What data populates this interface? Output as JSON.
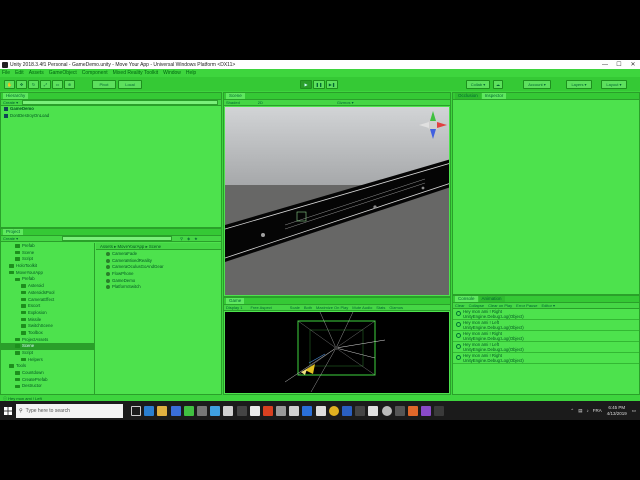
{
  "window": {
    "title": "Unity 2018.3.4f1 Personal - GameDemo.unity - Move Your App - Universal Windows Platform <DX11>",
    "minimize": "—",
    "maximize": "☐",
    "close": "✕"
  },
  "menu": [
    "File",
    "Edit",
    "Assets",
    "GameObject",
    "Component",
    "Mixed Reality Toolkit",
    "Window",
    "Help"
  ],
  "toolbar": {
    "pivot": "Pivot",
    "local": "Local",
    "collab": "Collab ▾",
    "account": "Account ▾",
    "layers": "Layers ▾",
    "layout": "Layout ▾"
  },
  "hierarchy": {
    "tab": "Hierarchy",
    "create": "Create ▾",
    "search_placeholder": "All",
    "items": [
      "GameDemo",
      "DontDestroyOnLoad"
    ]
  },
  "scene": {
    "tab": "Scene",
    "shading": "Shaded",
    "mode_2d": "2D",
    "gizmos": "Gizmos ▾",
    "search_placeholder": "All"
  },
  "game": {
    "tab": "Game",
    "display": "Display 1",
    "aspect": "Free Aspect",
    "scale": "Scale",
    "eye": "Both",
    "maximize": "Maximize On Play",
    "mute": "Mute Audio",
    "stats": "Stats",
    "gizmos": "Gizmos"
  },
  "inspector": {
    "tabs": [
      "Occlusion",
      "Inspector"
    ]
  },
  "project": {
    "tab": "Project",
    "create": "Create ▾",
    "tree": [
      {
        "label": "Prefab",
        "indent": 2
      },
      {
        "label": "Scene",
        "indent": 2
      },
      {
        "label": "Script",
        "indent": 2
      },
      {
        "label": "HoloToolkit",
        "indent": 1
      },
      {
        "label": "MoveYourApp",
        "indent": 1
      },
      {
        "label": "Prefab",
        "indent": 2
      },
      {
        "label": "Asteroid",
        "indent": 3
      },
      {
        "label": "AsteroidsPool",
        "indent": 3
      },
      {
        "label": "CameraEffect",
        "indent": 3
      },
      {
        "label": "Escort",
        "indent": 3
      },
      {
        "label": "Explosion",
        "indent": 3
      },
      {
        "label": "Missile",
        "indent": 3
      },
      {
        "label": "SwitchScene",
        "indent": 3
      },
      {
        "label": "Toolbox",
        "indent": 3
      },
      {
        "label": "ProjectAssets",
        "indent": 2
      },
      {
        "label": "Scene",
        "indent": 2,
        "selected": true
      },
      {
        "label": "Script",
        "indent": 2
      },
      {
        "label": "Helpers",
        "indent": 3
      },
      {
        "label": "Tools",
        "indent": 1
      },
      {
        "label": "Countdown",
        "indent": 2
      },
      {
        "label": "CreatePrefab",
        "indent": 2
      },
      {
        "label": "Destructor",
        "indent": 2
      }
    ],
    "breadcrumb": [
      "Assets",
      "MoveYourApp",
      "Scene"
    ],
    "assets": [
      "CameraFade",
      "CameraMixedReality",
      "CameraOculusGoAndGear",
      "FlowPhone",
      "GameDemo",
      "PlatformSwitch"
    ]
  },
  "console": {
    "tabs": [
      "Console",
      "Animation"
    ],
    "buttons": [
      "Clear",
      "Collapse",
      "Clear on Play",
      "Error Pause",
      "Editor ▾"
    ],
    "entries": [
      {
        "line1": "Hey mon ami ! Right",
        "line2": "UnityEngine.Debug:Log(Object)"
      },
      {
        "line1": "Hey mon ami ! Left",
        "line2": "UnityEngine.Debug:Log(Object)"
      },
      {
        "line1": "Hey mon ami ! Right",
        "line2": "UnityEngine.Debug:Log(Object)"
      },
      {
        "line1": "Hey mon ami ! Left",
        "line2": "UnityEngine.Debug:Log(Object)"
      },
      {
        "line1": "Hey mon ami ! Right",
        "line2": "UnityEngine.Debug:Log(Object)"
      }
    ]
  },
  "status": "Hey mon ami ! Left",
  "taskbar": {
    "search_placeholder": "Type here to search",
    "language": "FRA",
    "time": "6:45 PM",
    "date": "4/13/2019"
  }
}
